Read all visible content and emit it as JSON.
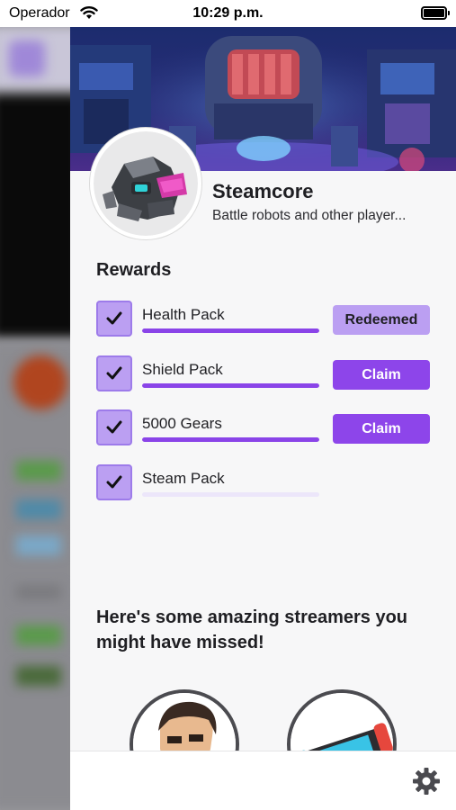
{
  "status_bar": {
    "carrier": "Operador",
    "time": "10:29 p.m."
  },
  "streamer": {
    "name": "Steamcore",
    "description": "Battle robots and other player..."
  },
  "rewards": {
    "title": "Rewards",
    "items": [
      {
        "label": "Health Pack",
        "progress": 1.0,
        "button": "Redeemed",
        "state": "redeemed"
      },
      {
        "label": "Shield Pack",
        "progress": 1.0,
        "button": "Claim",
        "state": "claim"
      },
      {
        "label": "5000 Gears",
        "progress": 1.0,
        "button": "Claim",
        "state": "claim"
      },
      {
        "label": "Steam Pack",
        "progress": 0.0,
        "button": "",
        "state": "none"
      }
    ]
  },
  "promo": {
    "title": "Here's some amazing streamers you might have missed!"
  },
  "footer": {
    "settings_icon": "gear-icon"
  },
  "colors": {
    "accent": "#8d45ea",
    "accent_light": "#bb9ff2",
    "background": "#f7f7f8"
  }
}
